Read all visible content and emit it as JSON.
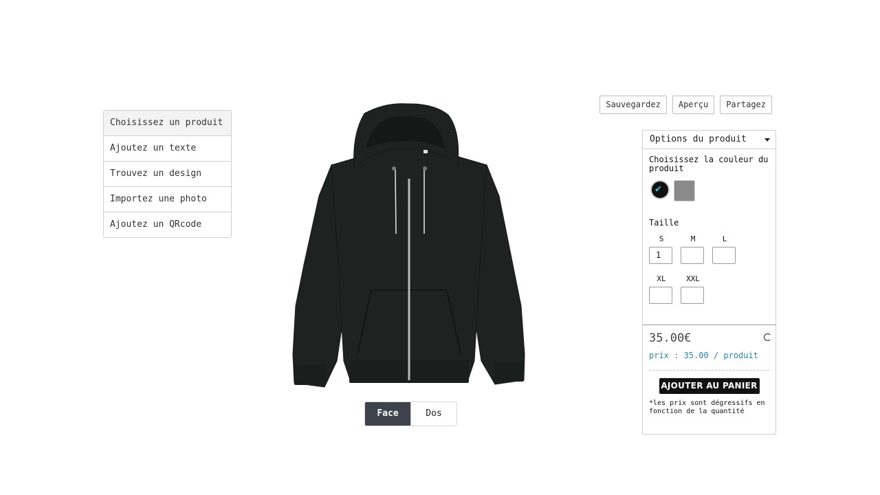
{
  "menu": {
    "items": [
      {
        "label": "Choisissez un produit",
        "active": true
      },
      {
        "label": "Ajoutez un texte"
      },
      {
        "label": "Trouvez un design"
      },
      {
        "label": "Importez une photo"
      },
      {
        "label": "Ajoutez un QRcode"
      }
    ]
  },
  "actions": {
    "save_label": "Sauvegardez",
    "preview_label": "Aperçu",
    "share_label": "Partagez"
  },
  "view_toggle": {
    "front_label": "Face",
    "back_label": "Dos",
    "selected": "Face"
  },
  "options": {
    "header_label": "Options du produit",
    "color_title": "Choisissez la couleur du produit",
    "colors": [
      {
        "name": "black",
        "hex": "#111111",
        "selected": true
      },
      {
        "name": "grey",
        "hex": "#8a8a8a",
        "selected": false
      }
    ],
    "size_title": "Taille",
    "sizes": [
      {
        "label": "S",
        "value": "1"
      },
      {
        "label": "M",
        "value": ""
      },
      {
        "label": "L",
        "value": ""
      },
      {
        "label": "XL",
        "value": ""
      },
      {
        "label": "XXL",
        "value": ""
      }
    ]
  },
  "pricing": {
    "total": "35.00€",
    "unit_price_text": "prix : 35.00 / produit",
    "cart_label": "AJOUTER AU PANIER",
    "note": "*les prix sont dégressifs en fonction de la quantité"
  },
  "product": {
    "garment_color": "#1e2322",
    "zipper_color": "#b9b9b9"
  }
}
